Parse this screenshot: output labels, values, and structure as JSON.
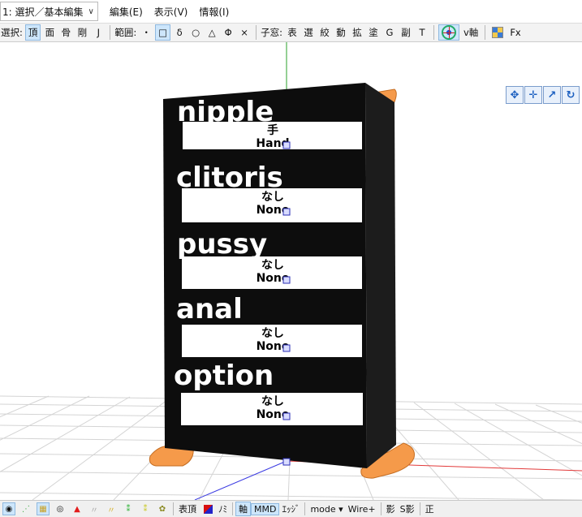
{
  "menubar": {
    "mode": "1: 選択／基本編集",
    "menus": [
      "編集(E)",
      "表示(V)",
      "情報(I)"
    ]
  },
  "toolbar": {
    "select_label": "選択:",
    "select_items": [
      "頂",
      "面",
      "骨",
      "剛",
      "J"
    ],
    "range_label": "範囲:",
    "range_items": [
      "・",
      "□",
      "δ",
      "○",
      "△",
      "Φ",
      "×"
    ],
    "child_label": "子窓:",
    "child_items": [
      "表",
      "選",
      "絞",
      "動",
      "拡",
      "塗",
      "G",
      "副",
      "T"
    ],
    "v_axis": "v軸",
    "fx": "Fx"
  },
  "board": {
    "rows": [
      {
        "title": "nipple",
        "jp": "手",
        "en": "Hand"
      },
      {
        "title": "clitoris",
        "jp": "なし",
        "en": "None"
      },
      {
        "title": "pussy",
        "jp": "なし",
        "en": "None"
      },
      {
        "title": "anal",
        "jp": "なし",
        "en": "None"
      },
      {
        "title": "option",
        "jp": "なし",
        "en": "None"
      }
    ]
  },
  "statusbar": {
    "texts": [
      "表頂",
      "ﾉﾐ",
      "軸",
      "MMD",
      "ｴｯｼﾞ",
      "mode ▾",
      "Wire+",
      "影",
      "S影",
      "正"
    ]
  },
  "colors": {
    "board_black": "#0d0d0d",
    "board_side": "#1c1c1c",
    "feet_orange": "#f59a4a",
    "active_blue": "#cde6fb",
    "grid_gray": "#d2d2d2"
  }
}
